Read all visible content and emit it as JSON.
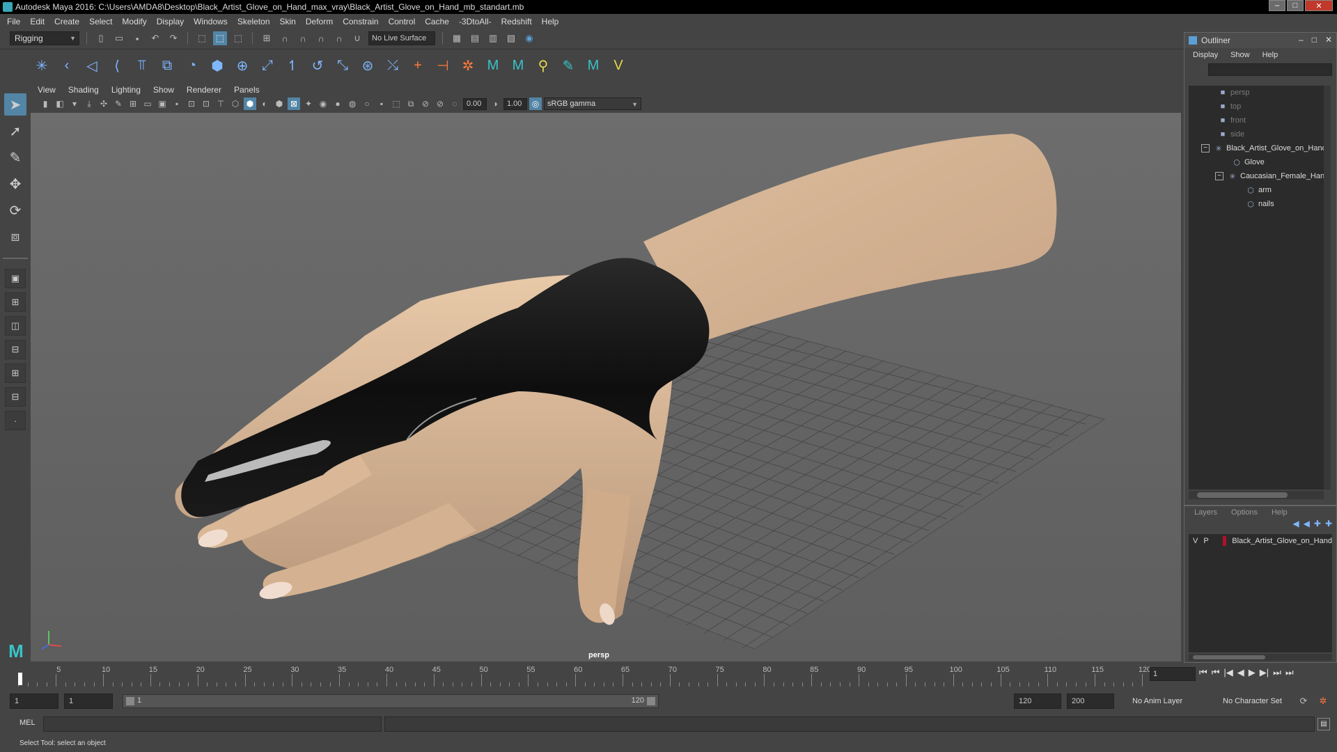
{
  "window": {
    "title": "Autodesk Maya 2016: C:\\Users\\AMDA8\\Desktop\\Black_Artist_Glove_on_Hand_max_vray\\Black_Artist_Glove_on_Hand_mb_standart.mb",
    "controls": {
      "minimize": "–",
      "maximize": "□",
      "close": "✕"
    }
  },
  "menubar": [
    "File",
    "Edit",
    "Create",
    "Select",
    "Modify",
    "Display",
    "Windows",
    "Skeleton",
    "Skin",
    "Deform",
    "Constrain",
    "Control",
    "Cache",
    "-3DtoAll-",
    "Redshift",
    "Help"
  ],
  "statusline": {
    "menuset": "Rigging",
    "live_surface": "No Live Surface"
  },
  "viewport": {
    "menus": [
      "View",
      "Shading",
      "Lighting",
      "Show",
      "Renderer",
      "Panels"
    ],
    "exposure": "0.00",
    "gamma": "1.00",
    "color_space": "sRGB gamma",
    "camera_label": "persp"
  },
  "outliner": {
    "title": "Outliner",
    "controls": {
      "minimize": "–",
      "maximize": "□",
      "close": "✕"
    },
    "menus": [
      "Display",
      "Show",
      "Help"
    ],
    "items": [
      {
        "label": "persp",
        "dim": true
      },
      {
        "label": "top",
        "dim": true
      },
      {
        "label": "front",
        "dim": true
      },
      {
        "label": "side",
        "dim": true
      },
      {
        "label": "Black_Artist_Glove_on_Hand",
        "dim": false,
        "expanded": true
      },
      {
        "label": "Glove",
        "dim": false
      },
      {
        "label": "Caucasian_Female_Hand",
        "dim": false,
        "expanded": true
      },
      {
        "label": "arm",
        "dim": false
      },
      {
        "label": "nails",
        "dim": false
      }
    ]
  },
  "layers": {
    "menus": [
      "Layers",
      "Options",
      "Help"
    ],
    "rows": [
      {
        "visible": "V",
        "playback": "P",
        "color": "#b0102c",
        "name": "Black_Artist_Glove_on_Hand"
      }
    ]
  },
  "timeslider": {
    "current_frame": "1",
    "tick_labels": [
      "1",
      "5",
      "10",
      "15",
      "20",
      "25",
      "30",
      "35",
      "40",
      "45",
      "50",
      "55",
      "60",
      "65",
      "70",
      "75",
      "80",
      "85",
      "90",
      "95",
      "100",
      "105",
      "110",
      "115",
      "120"
    ],
    "playback_controls": [
      "⏮",
      "⏮",
      "|◀",
      "◀",
      "▶",
      "▶|",
      "⏭",
      "⏭"
    ]
  },
  "rangeslider": {
    "anim_start": "1",
    "range_start": "1",
    "range_bar_start": "1",
    "range_bar_end": "120",
    "range_end": "120",
    "anim_end": "200",
    "anim_layer": "No Anim Layer",
    "character_set": "No Character Set"
  },
  "cmdline": {
    "label": "MEL"
  },
  "helpline": {
    "text": "Select Tool: select an object"
  }
}
